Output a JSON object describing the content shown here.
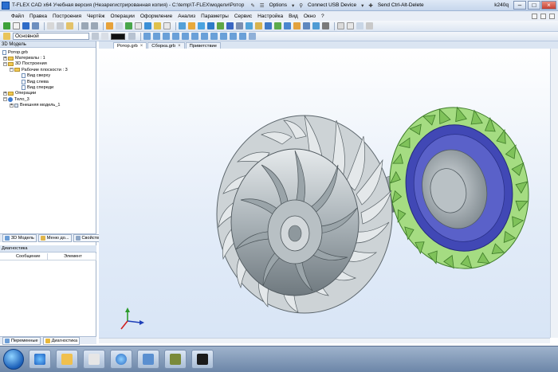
{
  "window": {
    "title": "T-FLEX CAD x64 Учебная версия (Незарегистрированная копия) - C:\\temp\\T-FLEX\\модели\\Ротор",
    "options_label": "Options",
    "usb_label": "Connect USB Device",
    "cad_label": "Send Ctrl-Alt-Delete",
    "user": "k240q"
  },
  "menu": {
    "items": [
      "Файл",
      "Правка",
      "Построения",
      "Чертёж",
      "Операции",
      "Оформление",
      "Анализ",
      "Параметры",
      "Сервис",
      "Настройка",
      "Вид",
      "Окно",
      "?"
    ]
  },
  "toolbar2": {
    "layer_value": "Основной"
  },
  "left_panel": {
    "header": "3D Модель",
    "tree": [
      {
        "label": "Ротор.grb",
        "indent": 0,
        "icon": "model-icon"
      },
      {
        "label": "Материалы : 1",
        "indent": 1,
        "icon": "folder-icon"
      },
      {
        "label": "3D Построения",
        "indent": 1,
        "icon": "folder-icon"
      },
      {
        "label": "Рабочие плоскости : 3",
        "indent": 2,
        "icon": "folder-icon"
      },
      {
        "label": "Вид сверху",
        "indent": 3,
        "icon": "plane-icon"
      },
      {
        "label": "Вид слева",
        "indent": 3,
        "icon": "plane-icon"
      },
      {
        "label": "Вид спереди",
        "indent": 3,
        "icon": "plane-icon"
      },
      {
        "label": "Операции",
        "indent": 1,
        "icon": "folder-icon"
      },
      {
        "label": "Тело_3",
        "indent": 1,
        "icon": "body-icon"
      },
      {
        "label": "Внешняя модель_1",
        "indent": 2,
        "icon": "external-model-icon"
      }
    ],
    "tabs": [
      "3D Модель",
      "Меню до...",
      "Свойства"
    ],
    "diagnostics_title": "Диагностика",
    "diagnostics_columns": [
      "Сообщение",
      "Элемент"
    ],
    "bottom_tabs": [
      "Переменные",
      "Диагностика"
    ]
  },
  "doc_tabs": [
    {
      "label": "Ротор.grb",
      "active": true
    },
    {
      "label": "Сборка.grb",
      "active": false
    },
    {
      "label": "Приветствие",
      "active": false
    }
  ],
  "colors": {
    "viewport_bg": "#e3ecf8",
    "metal": "#b9c2c6",
    "blades_green": "#8fcf6a",
    "ring_blue": "#3e45b8",
    "titlebar": "#c6d6ec"
  }
}
